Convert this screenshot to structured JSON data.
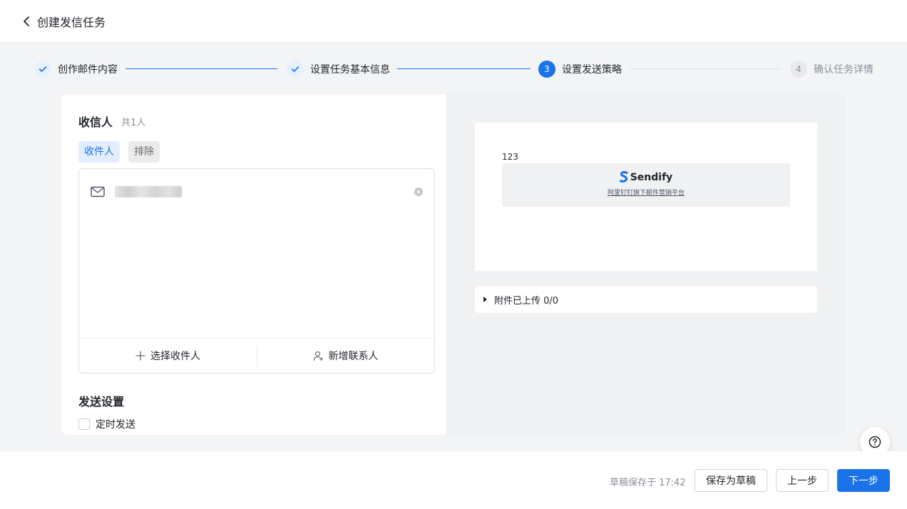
{
  "header": {
    "title": "创建发信任务"
  },
  "steps": [
    {
      "number": "1",
      "label": "创作邮件内容",
      "status": "done"
    },
    {
      "number": "2",
      "label": "设置任务基本信息",
      "status": "done"
    },
    {
      "number": "3",
      "label": "设置发送策略",
      "status": "active"
    },
    {
      "number": "4",
      "label": "确认任务详情",
      "status": "todo"
    }
  ],
  "recipients": {
    "title": "收信人",
    "count_text": "共1人",
    "tabs": [
      "收件人",
      "排除"
    ],
    "select_label": "选择收件人",
    "add_contact_label": "新增联系人"
  },
  "send_settings": {
    "title": "发送设置",
    "scheduled_label": "定时发送"
  },
  "preview": {
    "body_text": "123",
    "brand_name": "Sendify",
    "brand_link": "阿里钉钉旗下邮件营销平台",
    "attachment_text": "附件已上传 0/0"
  },
  "footer": {
    "draft_status": "草稿保存于 17:42",
    "save_draft": "保存为草稿",
    "prev": "上一步",
    "next": "下一步"
  },
  "colors": {
    "accent": "#1a73e8",
    "brand": "#1a73e8"
  }
}
